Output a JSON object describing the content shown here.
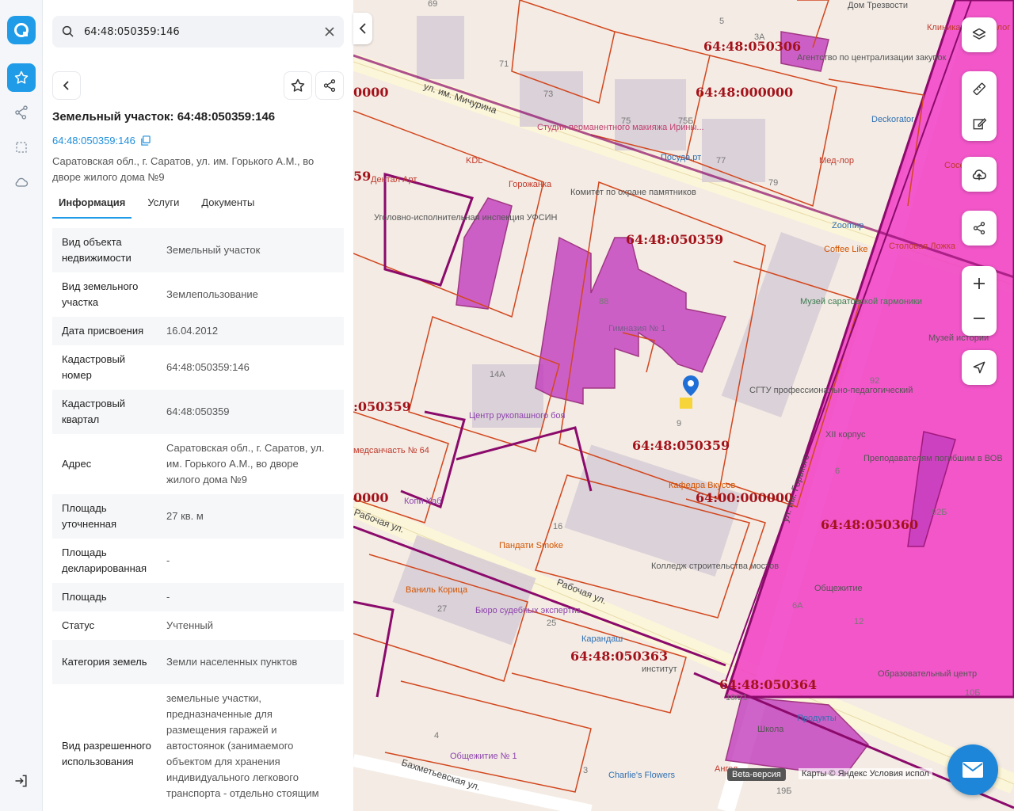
{
  "search": {
    "value": "64:48:050359:146"
  },
  "object": {
    "title": "Земельный участок: 64:48:050359:146",
    "cad_number": "64:48:050359:146",
    "address": "Саратовская обл., г. Саратов, ул. им. Горького А.М., во дворе жилого дома №9"
  },
  "tabs": [
    {
      "label": "Информация",
      "active": true
    },
    {
      "label": "Услуги",
      "active": false
    },
    {
      "label": "Документы",
      "active": false
    }
  ],
  "props": [
    {
      "key": "Вид объекта недвижимости",
      "value": "Земельный участок"
    },
    {
      "key": "Вид земельного участка",
      "value": "Землепользование"
    },
    {
      "key": "Дата присвоения",
      "value": "16.04.2012"
    },
    {
      "key": "Кадастровый номер",
      "value": "64:48:050359:146"
    },
    {
      "key": "Кадастровый квартал",
      "value": "64:48:050359"
    },
    {
      "key": "Адрес",
      "value": "Саратовская обл., г. Саратов, ул. им. Горького А.М., во дворе жилого дома №9"
    },
    {
      "key": "Площадь уточненная",
      "value": "27 кв. м"
    },
    {
      "key": "Площадь декларированная",
      "value": "-"
    },
    {
      "key": "Площадь",
      "value": "-"
    },
    {
      "key": "Статус",
      "value": "Учтенный"
    },
    {
      "key": "Категория земель",
      "value": "Земли населенных пунктов"
    },
    {
      "key": "Вид разрешенного использования",
      "value": "земельные участки, предназначенные для размещения гаражей и автостоянок (занимаемого объектом для хранения индивидуального легкового транспорта - отдельно стоящим"
    }
  ],
  "map": {
    "cad_labels": [
      "64:48:050306",
      "64:48:000000",
      "64:48:050359",
      "64:48:050359",
      "64:00:000000",
      "64:48:050360",
      "64:48:050363",
      "64:48:050364",
      "0000",
      ":050359",
      "0000",
      "59"
    ],
    "streets": [
      "ул. им. Мичурина",
      "Рабочая ул.",
      "ул. им. Горького",
      "Бахметьевская ул.",
      "Рабочая ул."
    ],
    "pois": [
      "Гимназия № 1",
      "Дентал Арт",
      "KDL",
      "Горожанка",
      "Комитет по охране памятников",
      "Уголовно-исполнительная инспекция УФСИН",
      "Студия перманентного макияжа Ирины...",
      "Посуда.рт",
      "Deckorator",
      "Мед-лор",
      "Zoomир",
      "Coffee Like",
      "Агентство по централизации закупок",
      "Дом Трезвости",
      "Клиника Стоматолог",
      "Музей саратовской гармоники",
      "СГТУ профессионально-педагогический",
      "Центр рукопашного боя",
      "Кафедра Вкусов",
      "Копи Хаб",
      "Пандати Smoke",
      "Ваниль Корица",
      "Бюро судебных экспертиз",
      "Колледж строительства мостов",
      "Карандаш",
      "институт",
      "Общежитие № 1",
      "Charlie's Flowers",
      "Продукты",
      "Общежитие",
      "Образовательный центр",
      "Музей истории",
      "Преподавателям погибшим в ВОВ",
      "XII корпус",
      "Столовая Ложка",
      "медсанчасть № 64",
      "Ангел",
      "Школа",
      "Соседи"
    ],
    "house_numbers": [
      "69",
      "71",
      "73",
      "75",
      "75Б",
      "77",
      "79",
      "5",
      "3А",
      "88",
      "14А",
      "16",
      "9",
      "27",
      "25",
      "4",
      "3",
      "19/21",
      "6",
      "6А",
      "12",
      "92",
      "92Б",
      "10Б",
      "19Б"
    ]
  },
  "footer": {
    "beta": "Beta-версия",
    "copyright": "Карты © Яндекс   Условия испол"
  }
}
